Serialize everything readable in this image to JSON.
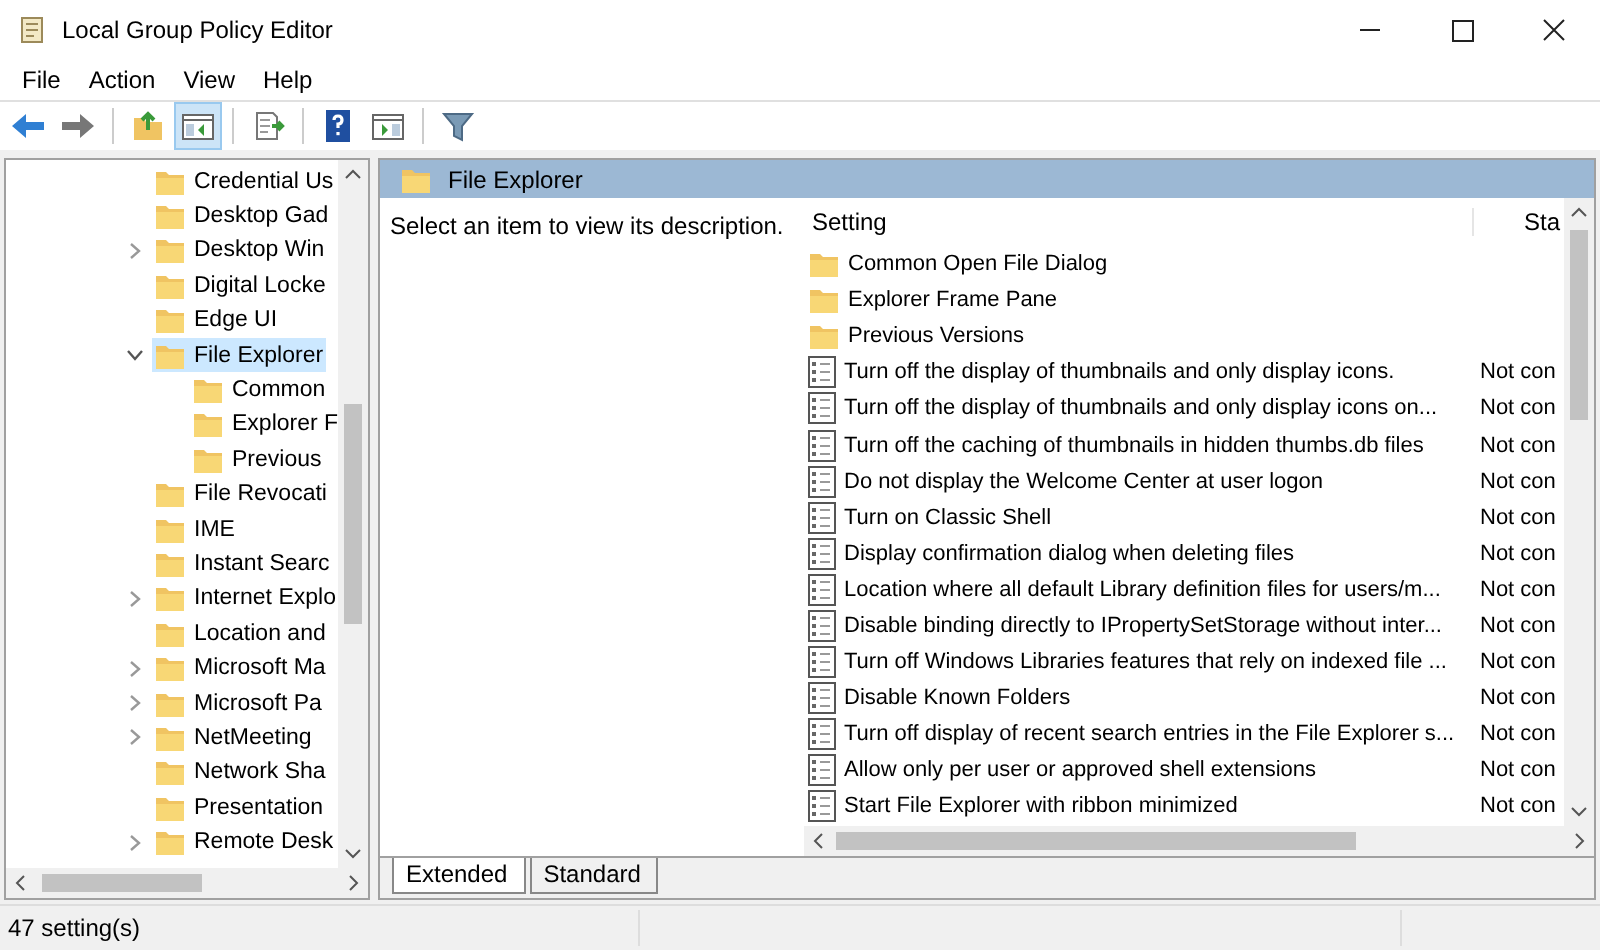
{
  "window": {
    "title": "Local Group Policy Editor"
  },
  "menu": [
    "File",
    "Action",
    "View",
    "Help"
  ],
  "toolbar": [
    {
      "kind": "back",
      "selected": false
    },
    {
      "kind": "forward",
      "selected": false
    },
    {
      "kind": "sep"
    },
    {
      "kind": "up",
      "selected": false
    },
    {
      "kind": "tree",
      "selected": true
    },
    {
      "kind": "sep"
    },
    {
      "kind": "export",
      "selected": false
    },
    {
      "kind": "sep"
    },
    {
      "kind": "help",
      "selected": false
    },
    {
      "kind": "pane",
      "selected": false
    },
    {
      "kind": "sep"
    },
    {
      "kind": "filter",
      "selected": false
    }
  ],
  "tree": [
    {
      "label": "Credential Us",
      "kind": "leaf",
      "selected": false
    },
    {
      "label": "Desktop Gad",
      "kind": "leaf",
      "selected": false
    },
    {
      "label": "Desktop Win",
      "kind": "branch",
      "expanded": false,
      "selected": false
    },
    {
      "label": "Digital Locke",
      "kind": "leaf",
      "selected": false
    },
    {
      "label": "Edge UI",
      "kind": "leaf",
      "selected": false
    },
    {
      "label": "File Explorer",
      "kind": "branch",
      "expanded": true,
      "selected": true,
      "children": [
        {
          "label": "Common",
          "kind": "leaf",
          "selected": false
        },
        {
          "label": "Explorer F",
          "kind": "leaf",
          "selected": false
        },
        {
          "label": "Previous",
          "kind": "leaf",
          "selected": false
        }
      ]
    },
    {
      "label": "File Revocati",
      "kind": "leaf",
      "selected": false
    },
    {
      "label": "IME",
      "kind": "leaf",
      "selected": false
    },
    {
      "label": "Instant Searc",
      "kind": "leaf",
      "selected": false
    },
    {
      "label": "Internet Explo",
      "kind": "branch",
      "expanded": false,
      "selected": false
    },
    {
      "label": "Location and",
      "kind": "leaf",
      "selected": false
    },
    {
      "label": "Microsoft Ma",
      "kind": "branch",
      "expanded": false,
      "selected": false
    },
    {
      "label": "Microsoft Pa",
      "kind": "branch",
      "expanded": false,
      "selected": false
    },
    {
      "label": "NetMeeting",
      "kind": "branch",
      "expanded": false,
      "selected": false
    },
    {
      "label": "Network Sha",
      "kind": "leaf",
      "selected": false
    },
    {
      "label": "Presentation",
      "kind": "leaf",
      "selected": false
    },
    {
      "label": "Remote Desk",
      "kind": "branch",
      "expanded": false,
      "selected": false
    }
  ],
  "detail": {
    "title": "File Explorer",
    "description": "Select an item to view its description.",
    "columns": [
      "Setting",
      "Sta"
    ],
    "rows": [
      {
        "kind": "folder",
        "setting": "Common Open File Dialog"
      },
      {
        "kind": "folder",
        "setting": "Explorer Frame Pane"
      },
      {
        "kind": "folder",
        "setting": "Previous Versions"
      },
      {
        "kind": "policy",
        "setting": "Turn off the display of thumbnails and only display icons.",
        "state": "Not con"
      },
      {
        "kind": "policy",
        "setting": "Turn off the display of thumbnails and only display icons on...",
        "state": "Not con"
      },
      {
        "kind": "policy",
        "setting": "Turn off the caching of thumbnails in hidden thumbs.db files",
        "state": "Not con"
      },
      {
        "kind": "policy",
        "setting": "Do not display the Welcome Center at user logon",
        "state": "Not con"
      },
      {
        "kind": "policy",
        "setting": "Turn on Classic Shell",
        "state": "Not con"
      },
      {
        "kind": "policy",
        "setting": "Display confirmation dialog when deleting files",
        "state": "Not con"
      },
      {
        "kind": "policy",
        "setting": "Location where all default Library definition files for users/m...",
        "state": "Not con"
      },
      {
        "kind": "policy",
        "setting": "Disable binding directly to IPropertySetStorage without inter...",
        "state": "Not con"
      },
      {
        "kind": "policy",
        "setting": "Turn off Windows Libraries features that rely on indexed file ...",
        "state": "Not con"
      },
      {
        "kind": "policy",
        "setting": "Disable Known Folders",
        "state": "Not con"
      },
      {
        "kind": "policy",
        "setting": "Turn off display of recent search entries in the File Explorer s...",
        "state": "Not con"
      },
      {
        "kind": "policy",
        "setting": "Allow only per user or approved shell extensions",
        "state": "Not con"
      },
      {
        "kind": "policy",
        "setting": "Start File Explorer with ribbon minimized",
        "state": "Not con"
      }
    ],
    "tabs": [
      {
        "label": "Extended",
        "selected": true
      },
      {
        "label": "Standard",
        "selected": false
      }
    ]
  },
  "status_bar": "47 setting(s)"
}
